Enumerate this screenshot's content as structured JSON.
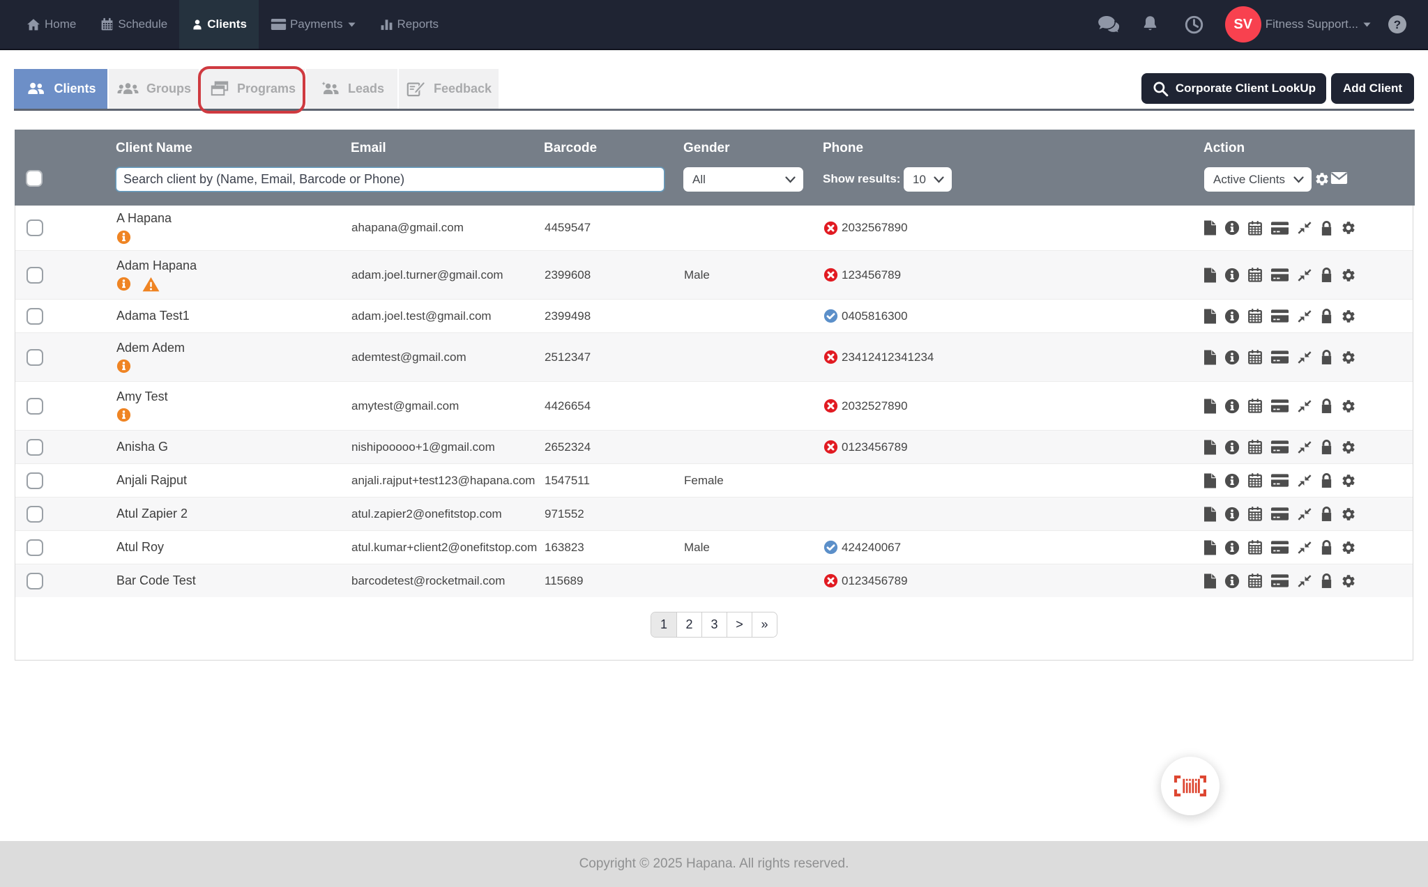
{
  "navbar": {
    "items": [
      {
        "label": "Home",
        "icon": "home-icon",
        "active": false,
        "caret": false
      },
      {
        "label": "Schedule",
        "icon": "schedule-icon",
        "active": false,
        "caret": false
      },
      {
        "label": "Clients",
        "icon": "user-icon",
        "active": true,
        "caret": false
      },
      {
        "label": "Payments",
        "icon": "credit-card-icon",
        "active": false,
        "caret": true
      },
      {
        "label": "Reports",
        "icon": "bar-chart-icon",
        "active": false,
        "caret": false
      }
    ],
    "right": {
      "icons": [
        "comments-icon",
        "bell-icon",
        "clock-icon"
      ],
      "avatar_initials": "SV",
      "account_label": "Fitness Support...",
      "help_icon": "question-icon"
    }
  },
  "tabs": [
    {
      "label": "Clients",
      "icon": "clients-tab-icon",
      "active": true,
      "annotated": false
    },
    {
      "label": "Groups",
      "icon": "groups-tab-icon",
      "active": false,
      "annotated": false
    },
    {
      "label": "Programs",
      "icon": "programs-tab-icon",
      "active": false,
      "annotated": true
    },
    {
      "label": "Leads",
      "icon": "leads-tab-icon",
      "active": false,
      "annotated": false
    },
    {
      "label": "Feedback",
      "icon": "feedback-tab-icon",
      "active": false,
      "annotated": false
    }
  ],
  "toolbar": {
    "lookup_label": "Corporate Client LookUp",
    "add_label": "Add Client"
  },
  "table": {
    "columns": {
      "client_name": "Client Name",
      "email": "Email",
      "barcode": "Barcode",
      "gender": "Gender",
      "phone": "Phone",
      "action": "Action"
    },
    "controls": {
      "search_placeholder": "Search client by (Name, Email, Barcode or Phone)",
      "gender_filter_value": "All",
      "show_results_label": "Show results:",
      "page_size_value": "10",
      "status_filter_value": "Active Clients",
      "icons": [
        "gear-icon",
        "envelope-icon"
      ]
    },
    "action_icons": [
      "file-icon",
      "info-circle-icon",
      "calendar-icon",
      "credit-card-solid-icon",
      "compress-icon",
      "lock-icon",
      "gear-icon"
    ],
    "rows": [
      {
        "name": "A Hapana",
        "info": true,
        "warning": false,
        "email": "ahapana@gmail.com",
        "barcode": "4459547",
        "gender": "",
        "phone": "2032567890",
        "phone_status": "invalid"
      },
      {
        "name": "Adam Hapana",
        "info": true,
        "warning": true,
        "email": "adam.joel.turner@gmail.com",
        "barcode": "2399608",
        "gender": "Male",
        "phone": "123456789",
        "phone_status": "invalid"
      },
      {
        "name": "Adama Test1",
        "info": false,
        "warning": false,
        "email": "adam.joel.test@gmail.com",
        "barcode": "2399498",
        "gender": "",
        "phone": "0405816300",
        "phone_status": "valid"
      },
      {
        "name": "Adem Adem",
        "info": true,
        "warning": false,
        "email": "ademtest@gmail.com",
        "barcode": "2512347",
        "gender": "",
        "phone": "23412412341234",
        "phone_status": "invalid"
      },
      {
        "name": "Amy Test",
        "info": true,
        "warning": false,
        "email": "amytest@gmail.com",
        "barcode": "4426654",
        "gender": "",
        "phone": "2032527890",
        "phone_status": "invalid"
      },
      {
        "name": "Anisha G",
        "info": false,
        "warning": false,
        "email": "nishipooooo+1@gmail.com",
        "barcode": "2652324",
        "gender": "",
        "phone": "0123456789",
        "phone_status": "invalid"
      },
      {
        "name": "Anjali Rajput",
        "info": false,
        "warning": false,
        "email": "anjali.rajput+test123@hapana.com",
        "barcode": "1547511",
        "gender": "Female",
        "phone": "",
        "phone_status": "none"
      },
      {
        "name": "Atul Zapier 2",
        "info": false,
        "warning": false,
        "email": "atul.zapier2@onefitstop.com",
        "barcode": "971552",
        "gender": "",
        "phone": "",
        "phone_status": "none"
      },
      {
        "name": "Atul Roy",
        "info": false,
        "warning": false,
        "email": "atul.kumar+client2@onefitstop.com",
        "barcode": "163823",
        "gender": "Male",
        "phone": "424240067",
        "phone_status": "valid"
      },
      {
        "name": "Bar Code Test",
        "info": false,
        "warning": false,
        "email": "barcodetest@rocketmail.com",
        "barcode": "115689",
        "gender": "",
        "phone": "0123456789",
        "phone_status": "invalid"
      }
    ]
  },
  "pagination": {
    "pages": [
      "1",
      "2",
      "3",
      ">",
      "»"
    ],
    "active": "1"
  },
  "fab": {
    "icon": "barcode-scan-icon"
  },
  "footer": {
    "copyright": "Copyright © 2025 Hapana. All rights reserved."
  },
  "colors": {
    "navbar_bg": "#1f2433",
    "active_nav_bg": "#25323e",
    "active_tab_bg": "#6d8fc7",
    "annotation_red": "#cf3a40",
    "table_header_bg": "#767e88",
    "info_orange": "#ef8423",
    "invalid_red": "#e11b22",
    "valid_blue": "#5b8fc9",
    "avatar_red": "#f8414f",
    "barcode_red": "#dd4732",
    "footer_bg": "#dcdcdc"
  }
}
